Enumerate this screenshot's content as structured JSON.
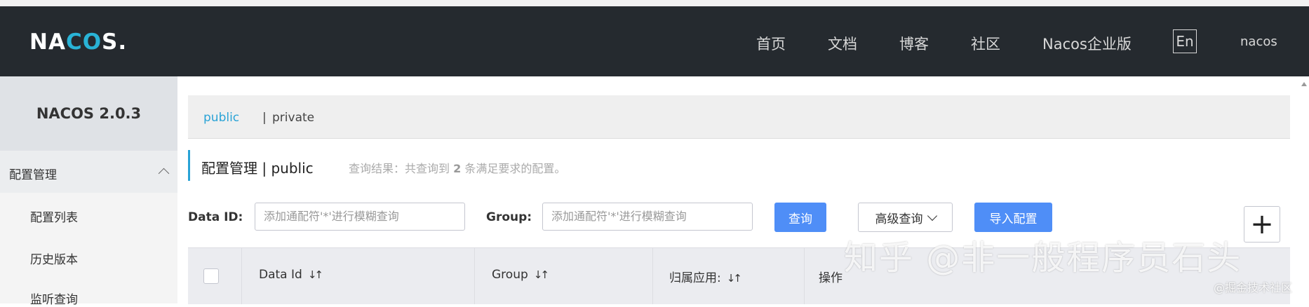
{
  "header": {
    "logo_main": "NA",
    "logo_accent": "CO",
    "logo_tail": "S.",
    "nav": [
      "首页",
      "文档",
      "博客",
      "社区",
      "Nacos企业版"
    ],
    "lang_button": "En",
    "user": "nacos"
  },
  "sidebar": {
    "version": "NACOS 2.0.3",
    "group_label": "配置管理",
    "items": [
      "配置列表",
      "历史版本",
      "监听查询"
    ]
  },
  "namespace": {
    "active": "public",
    "separator": "|",
    "other": "private"
  },
  "page": {
    "title": "配置管理 | public",
    "result_prefix": "查询结果：共查询到 ",
    "result_count": "2",
    "result_suffix": " 条满足要求的配置。"
  },
  "search": {
    "data_id_label": "Data ID:",
    "data_id_placeholder": "添加通配符'*'进行模糊查询",
    "group_label": "Group:",
    "group_placeholder": "添加通配符'*'进行模糊查询",
    "query_button": "查询",
    "advanced_button": "高级查询",
    "import_button": "导入配置",
    "add_button": "+"
  },
  "table": {
    "columns": [
      "Data Id",
      "Group",
      "归属应用:",
      "操作"
    ]
  },
  "watermark": {
    "main": "知乎 @非一般程序员石头",
    "secondary": "@掘金技术社区"
  },
  "colors": {
    "header_bg": "#252a2f",
    "accent": "#29a3d6",
    "primary_button": "#4f8ef7"
  }
}
